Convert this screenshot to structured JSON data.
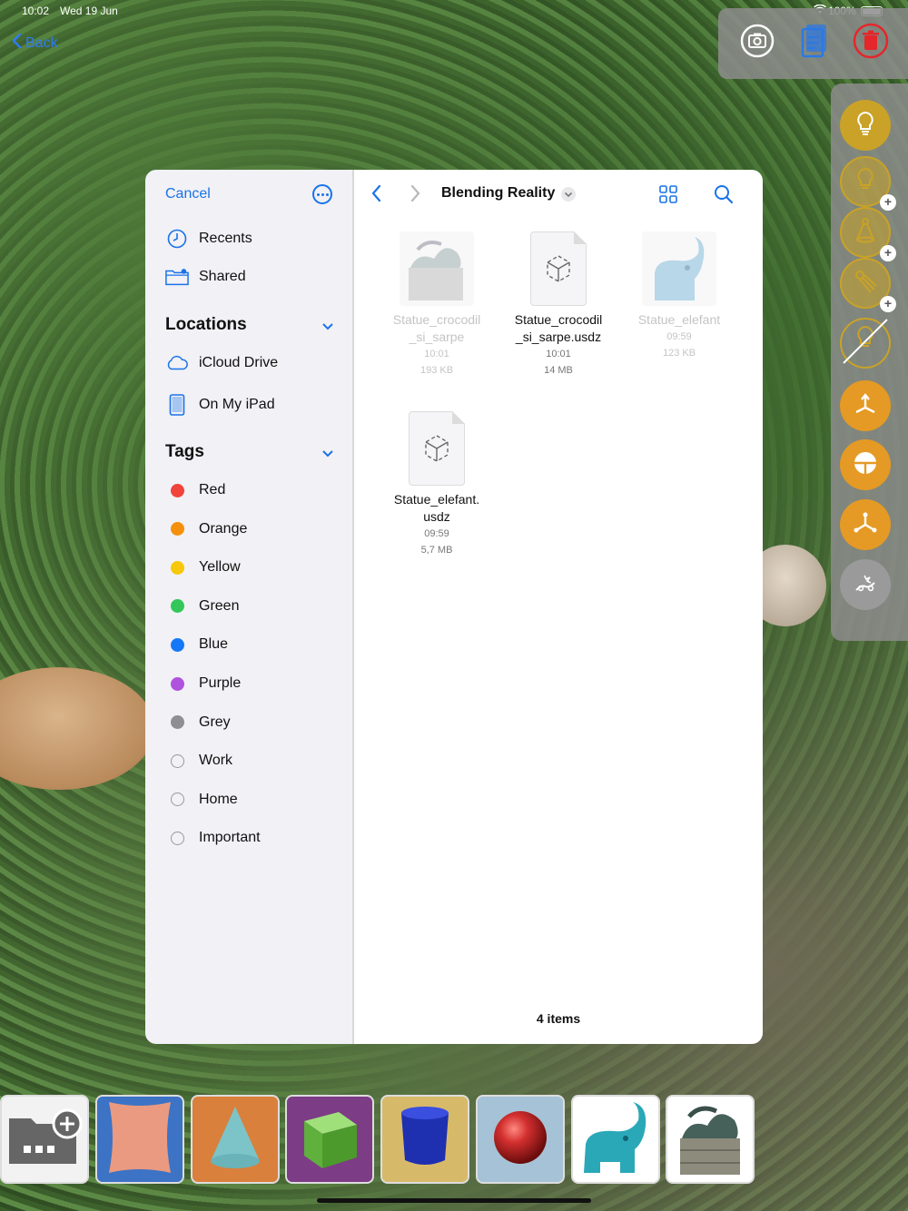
{
  "status": {
    "time": "10:02",
    "date": "Wed 19 Jun",
    "battery": "100%"
  },
  "back_label": "Back",
  "sidebar": {
    "cancel": "Cancel",
    "items": [
      {
        "label": "Recents",
        "icon": "clock-icon"
      },
      {
        "label": "Shared",
        "icon": "shared-folder-icon"
      }
    ],
    "locations_title": "Locations",
    "locations": [
      {
        "label": "iCloud Drive",
        "icon": "cloud-icon"
      },
      {
        "label": "On My iPad",
        "icon": "ipad-icon"
      }
    ],
    "tags_title": "Tags",
    "tags": [
      {
        "label": "Red",
        "color": "#f0433a"
      },
      {
        "label": "Orange",
        "color": "#f4900c"
      },
      {
        "label": "Yellow",
        "color": "#f7c70a"
      },
      {
        "label": "Green",
        "color": "#33c759"
      },
      {
        "label": "Blue",
        "color": "#1477f7"
      },
      {
        "label": "Purple",
        "color": "#af52de"
      },
      {
        "label": "Grey",
        "color": "#8e8e93"
      },
      {
        "label": "Work",
        "color": ""
      },
      {
        "label": "Home",
        "color": ""
      },
      {
        "label": "Important",
        "color": ""
      }
    ]
  },
  "main": {
    "title": "Blending Reality",
    "files": [
      {
        "name_line1": "Statue_crocodil",
        "name_line2": "_si_sarpe",
        "time": "10:01",
        "size": "193 KB",
        "dim": true,
        "kind": "crocodile-thumbnail"
      },
      {
        "name_line1": "Statue_crocodil",
        "name_line2": "_si_sarpe.usdz",
        "time": "10:01",
        "size": "14 MB",
        "dim": false,
        "kind": "usdz-document-icon"
      },
      {
        "name_line1": "Statue_elefant",
        "name_line2": "",
        "time": "09:59",
        "size": "123 KB",
        "dim": true,
        "kind": "elephant-thumbnail"
      },
      {
        "name_line1": "Statue_elefant.",
        "name_line2": "usdz",
        "time": "09:59",
        "size": "5,7 MB",
        "dim": false,
        "kind": "usdz-document-icon"
      }
    ],
    "item_count": "4 items"
  },
  "accent": "#1a73e8"
}
